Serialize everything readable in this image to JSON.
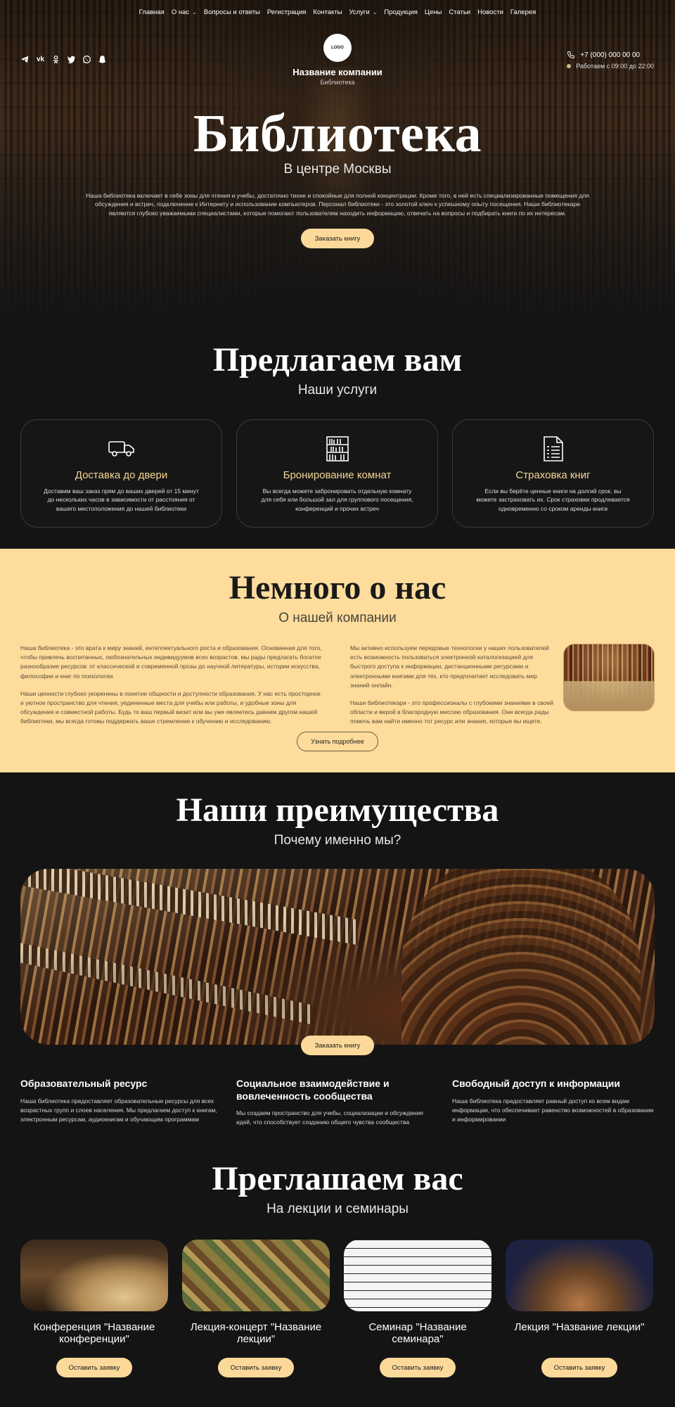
{
  "nav": {
    "items": [
      "Главная",
      "О нас",
      "Вопросы и ответы",
      "Регистрация",
      "Контакты",
      "Услуги",
      "Продукция",
      "Цены",
      "Статьи",
      "Новости",
      "Галерея"
    ]
  },
  "header": {
    "logo_text": "LOGO",
    "company_name": "Название компании",
    "company_sub": "Библиотека",
    "phone": "+7 (000) 000 00 00",
    "hours": "Работаем с 09:00 до 22:00",
    "social": [
      "telegram-icon",
      "vk-icon",
      "ok-icon",
      "twitter-icon",
      "whatsapp-icon",
      "snapchat-icon"
    ]
  },
  "hero": {
    "title": "Библиотека",
    "subtitle": "В центре Москвы",
    "text": "Наша библиотека включает в себе зоны для чтения и учебы, достаточно тихие и спокойные для полной концентрации. Кроме того, в ней есть специализированные помещения для обсуждения и встреч, подключение к Интернету и использование компьютеров. Персонал библиотеки - это золотой ключ к успешному опыту посещения. Наши библиотекари являются глубоко уважаемыми специалистами, которые помогают пользователям находить информацию, отвечать на вопросы и подбирать книги по их интересам.",
    "button": "Заказать книгу"
  },
  "services": {
    "title": "Предлагаем вам",
    "subtitle": "Наши услуги",
    "cards": [
      {
        "title": "Доставка до двери",
        "text": "Доставим ваш заказ прям до ваших дверей от 15 минут до нескольких часов в зависимости от расстояния от вашего местоположения до нашей библиотеки"
      },
      {
        "title": "Бронирование комнат",
        "text": "Вы всегда можете забронировать отдельную комнату для себя или большой зал для группового посещения, конференций и прочих встреч"
      },
      {
        "title": "Страховка книг",
        "text": "Если вы берёте ценные книги на долгий срок, вы можете застраховать их. Срок страховки продлевается одновременно со сроком аренды книги"
      }
    ]
  },
  "about": {
    "title": "Немного о нас",
    "subtitle": "О нашей компании",
    "p1": "Наша библиотека - это врата к миру знаний, интеллектуального роста и образования. Основанная для того, чтобы привлечь воспитанных, любознательных индивидуумов всех возрастов, мы рады предлагать богатое разнообразие ресурсов: от классической и современной прозы до научной литературы, истории искусства, философии и книг по психологии.",
    "p2": "Наши ценности глубоко укоренены в понятии общности и доступности образования. У нас есть просторное и уютное пространство для чтения, уединенные места для учебы или работы, и удобные зоны для обсуждения и совместной работы. Будь то ваш первый визит или вы уже являетесь давним другом нашей библиотеки, мы всегда готовы поддержать ваше стремление к обучению и исследованию.",
    "p3": "Мы активно используем передовые технологии у наших пользователей есть возможность пользоваться электронной каталогизацией для быстрого доступа к информации, дистанционными ресурсами и электронными книгами для тех, кто предпочитает исследовать мир знаний онлайн.",
    "p4": "Наши библиотекари - это профессионалы с глубокими знаниями в своей области и верой в благородную миссию образования. Они всегда рады помочь вам найти именно тот ресурс или знания, которые вы ищете.",
    "button": "Узнать подробнее"
  },
  "advantages": {
    "title": "Наши преимущества",
    "subtitle": "Почему именно мы?",
    "button": "Заказать книгу",
    "items": [
      {
        "title": "Образовательный ресурс",
        "text": "Наша библиотека предоставляет образовательные ресурсы для всех возрастных групп и слоев населения. Мы предлагаем доступ к книгам, электронным ресурсам, аудиокнигам и обучающим программам"
      },
      {
        "title": "Социальное взаимодействие и вовлеченность сообщества",
        "text": "Мы создаем пространство для учебы, социализации и обсуждения идей, что способствует созданию общего чувства сообщества"
      },
      {
        "title": "Свободный доступ к информации",
        "text": "Наша библиотека предоставляет равный доступ ко всем видам информации, что обеспечивает равенство возможностей в образовании и информировании"
      }
    ]
  },
  "invite": {
    "title": "Преглашаем вас",
    "subtitle": "На лекции и семинары",
    "events": [
      {
        "title": "Конференция \"Название конференции\"",
        "button": "Оставить заявку"
      },
      {
        "title": "Лекция-концерт \"Название лекции\"",
        "button": "Оставить заявку"
      },
      {
        "title": "Семинар \"Название семинара\"",
        "button": "Оставить заявку"
      },
      {
        "title": "Лекция \"Название лекции\"",
        "button": "Оставить заявку"
      }
    ]
  },
  "colors": {
    "accent": "#fcd99a",
    "dark_bg": "#141414",
    "about_bg": "#fedc9b",
    "card_title": "#f5d694"
  }
}
